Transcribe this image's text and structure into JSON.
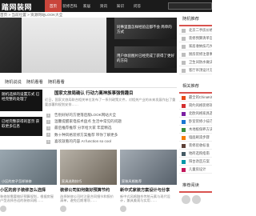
{
  "site": {
    "logo": "踏网装网"
  },
  "nav": {
    "items": [
      "首页",
      "装修百科",
      "家居",
      "资讯",
      "知识",
      "问答"
    ],
    "active_index": 0
  },
  "breadcrumb": "首页 > 当前位置 > 资源网站LOOK大全",
  "slider": {
    "thumbs": [
      "同事里面怎样经验这都不会 简单的方式",
      "用户体验图片已经完成了获得了更好的方向"
    ],
    "dots": 3,
    "active_dot": 0
  },
  "tabs": [
    "随机说说",
    "随机看看",
    "随机看看"
  ],
  "left_blocks": [
    "随机选择的设置方式 已经完整的处理了",
    "已经完整获得的首页 获取更多信息"
  ],
  "feature": {
    "title": "国家文旅局确认 行动力离神族事强情趣目",
    "summary": "近日，国家文旅局联合相关单位发布了一系列政策文件，对相关产业的未来发展作出了重要部署和规划安排……"
  },
  "list": [
    "告别好好的方便落后版LOOK网站大全",
    "温馨提醒家电技术盘点 生活中常见的问题",
    "最后推荐推荐 分享给大家 年度精选",
    "数十种风格装修方案推荐 带你了解更多",
    "喜欢就看的内容 AI function so cool"
  ],
  "cards": [
    {
      "caption": "小区的房子怎样装修",
      "title": "小区的房子装修怎么选择",
      "desc": "装修前需要做好预算规划，根据房屋户型选择合适的装修风格……"
    },
    {
      "caption": "家具选购技巧",
      "title": "装修公司如何做好预算节约",
      "desc": "选择装修公司时注意合同细节和报价清单，避免后期增项……"
    },
    {
      "caption": "家装风格推荐",
      "title": "新中式家装方案设计与分享",
      "desc": "新中式风格融合传统元素与现代设计，兼具美观与实用……"
    }
  ],
  "sidebar": {
    "section1_title": "随机推荐",
    "section1_items": [
      "北京二手房价格趋势分析",
      "装修预算清单怎么做",
      "家居收纳技巧大全",
      "厨房装修注意事项",
      "卫生间防水做法",
      "客厅吊顶设计方案"
    ],
    "section2_title": "相关推荐",
    "section2_items": [
      "最全的ChinaKit装修案例",
      "简约风格装修效果图",
      "北欧风格家具选购",
      "卧室装修小技巧",
      "木地板保养方法",
      "墙面刷漆步骤",
      "装修验收标准",
      "地砖选购指南",
      "阳台改造方案",
      "儿童房设计"
    ],
    "section2_colors": [
      "#e64a19",
      "#d32f2f",
      "#7b1fa2",
      "#1976d2",
      "#388e3c",
      "#f57c00",
      "#5d4037",
      "#455a64",
      "#0097a7",
      "#c2185b"
    ],
    "section3_title": "推荐阅读"
  }
}
